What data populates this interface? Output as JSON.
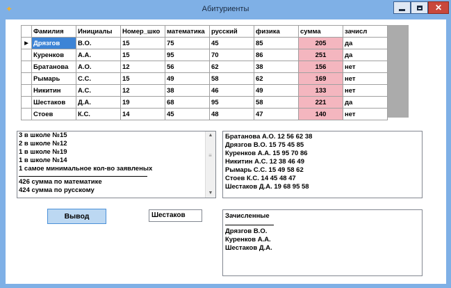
{
  "window": {
    "title": "Абитуриенты"
  },
  "grid": {
    "headers": [
      "Фамилия",
      "Инициалы",
      "Номер_шко",
      "математика",
      "русский",
      "физика",
      "сумма",
      "зачисл"
    ],
    "rows": [
      [
        "Дрязгов",
        "В.О.",
        "15",
        "75",
        "45",
        "85",
        "205",
        "да"
      ],
      [
        "Куренков",
        "А.А.",
        "15",
        "95",
        "70",
        "86",
        "251",
        "да"
      ],
      [
        "Братанова",
        "А.О.",
        "12",
        "56",
        "62",
        "38",
        "156",
        "нет"
      ],
      [
        "Рымарь",
        "С.С.",
        "15",
        "49",
        "58",
        "62",
        "169",
        "нет"
      ],
      [
        "Никитин",
        "А.С.",
        "12",
        "38",
        "46",
        "49",
        "133",
        "нет"
      ],
      [
        "Шестаков",
        "Д.А.",
        "19",
        "68",
        "95",
        "58",
        "221",
        "да"
      ],
      [
        "Стоев",
        "К.С.",
        "14",
        "45",
        "48",
        "47",
        "140",
        "нет"
      ]
    ],
    "current_row_marker": "▶"
  },
  "stats_list": {
    "lines_top": [
      "3  в школе №15",
      "2  в школе №12",
      "1  в школе №19",
      "1  в школе №14",
      "1 самое минимальное кол-во заявленых"
    ],
    "lines_bottom": [
      "426  сумма по математике",
      "424  сумма по русскому"
    ]
  },
  "sorted_list": {
    "lines": [
      "Братанова А.О. 12 56 62 38",
      "Дрязгов В.О. 15 75 45 85",
      "Куренков А.А. 15 95 70 86",
      "Никитин А.С. 12 38 46 49",
      "Рымарь С.С. 15 49 58 62",
      "Стоев К.С. 14 45 48 47",
      "Шестаков Д.А. 19 68 95 58"
    ]
  },
  "output_button": {
    "label": "Вывод"
  },
  "surname_input": {
    "value": "Шестаков"
  },
  "enrolled": {
    "header": "Зачисленные",
    "lines": [
      "Дрязгов В.О.",
      "Куренков А.А.",
      "Шестаков Д.А."
    ]
  },
  "colors": {
    "window_frame": "#7fb0e6",
    "sum_cell": "#f4b6bf",
    "selected_cell": "#3d84d6",
    "button_face": "#bcd8f2",
    "close_button": "#c9483c"
  }
}
